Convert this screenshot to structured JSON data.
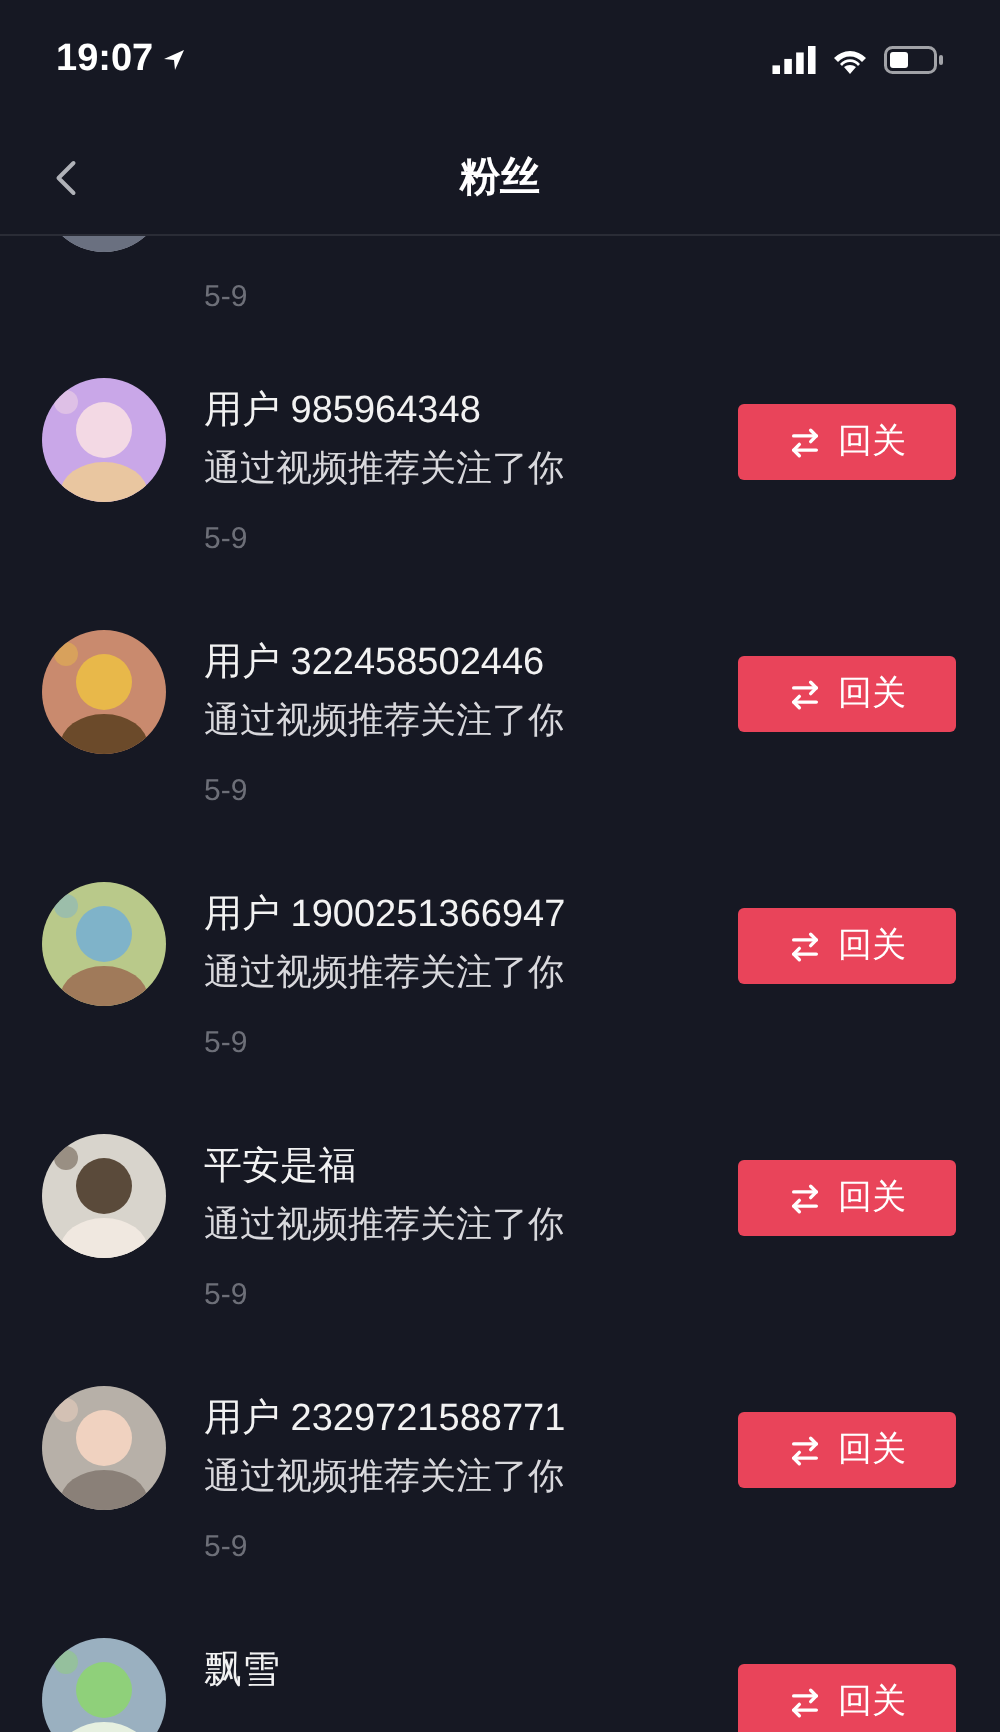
{
  "status_bar": {
    "time": "19:07"
  },
  "header": {
    "title": "粉丝"
  },
  "followers": [
    {
      "date": "5-9"
    },
    {
      "name": "用户 985964348",
      "subtitle": "通过视频推荐关注了你",
      "date": "5-9",
      "button": "回关"
    },
    {
      "name": "用户 322458502446",
      "subtitle": "通过视频推荐关注了你",
      "date": "5-9",
      "button": "回关"
    },
    {
      "name": "用户 1900251366947",
      "subtitle": "通过视频推荐关注了你",
      "date": "5-9",
      "button": "回关"
    },
    {
      "name": "平安是福",
      "subtitle": "通过视频推荐关注了你",
      "date": "5-9",
      "button": "回关"
    },
    {
      "name": "用户 2329721588771",
      "subtitle": "通过视频推荐关注了你",
      "date": "5-9",
      "button": "回关"
    },
    {
      "name": "飘雪",
      "button": "回关"
    }
  ]
}
